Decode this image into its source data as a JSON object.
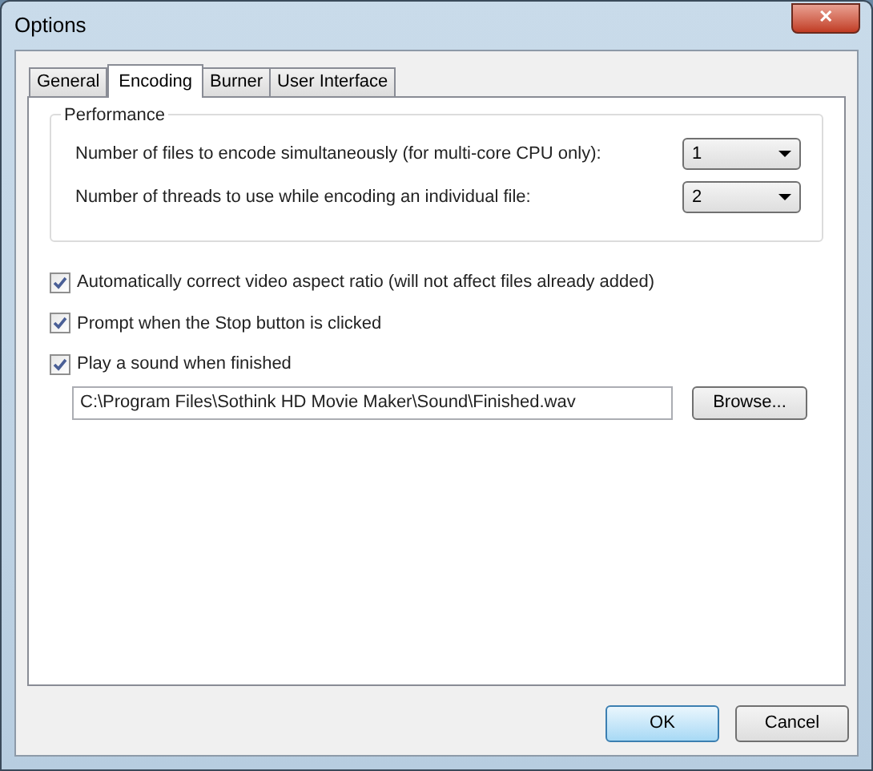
{
  "window": {
    "title": "Options",
    "close": "✕"
  },
  "tabs": [
    {
      "label": "General",
      "selected": false
    },
    {
      "label": "Encoding",
      "selected": true
    },
    {
      "label": "Burner",
      "selected": false
    },
    {
      "label": "User Interface",
      "selected": false
    }
  ],
  "performance": {
    "title": "Performance",
    "rows": [
      {
        "label": "Number of files to encode simultaneously (for multi-core CPU only):",
        "value": "1"
      },
      {
        "label": "Number of threads to use while encoding an individual file:",
        "value": "2"
      }
    ]
  },
  "options": [
    {
      "label": "Automatically correct video aspect ratio (will not affect files already added)",
      "checked": true
    },
    {
      "label": "Prompt when the Stop button is clicked",
      "checked": true
    },
    {
      "label": "Play a sound when finished",
      "checked": true
    }
  ],
  "sound_file": {
    "value": "C:\\Program Files\\Sothink HD Movie Maker\\Sound\\Finished.wav",
    "browse": "Browse..."
  },
  "buttons": [
    {
      "label": "OK",
      "default": true
    },
    {
      "label": "Cancel",
      "default": false
    }
  ]
}
